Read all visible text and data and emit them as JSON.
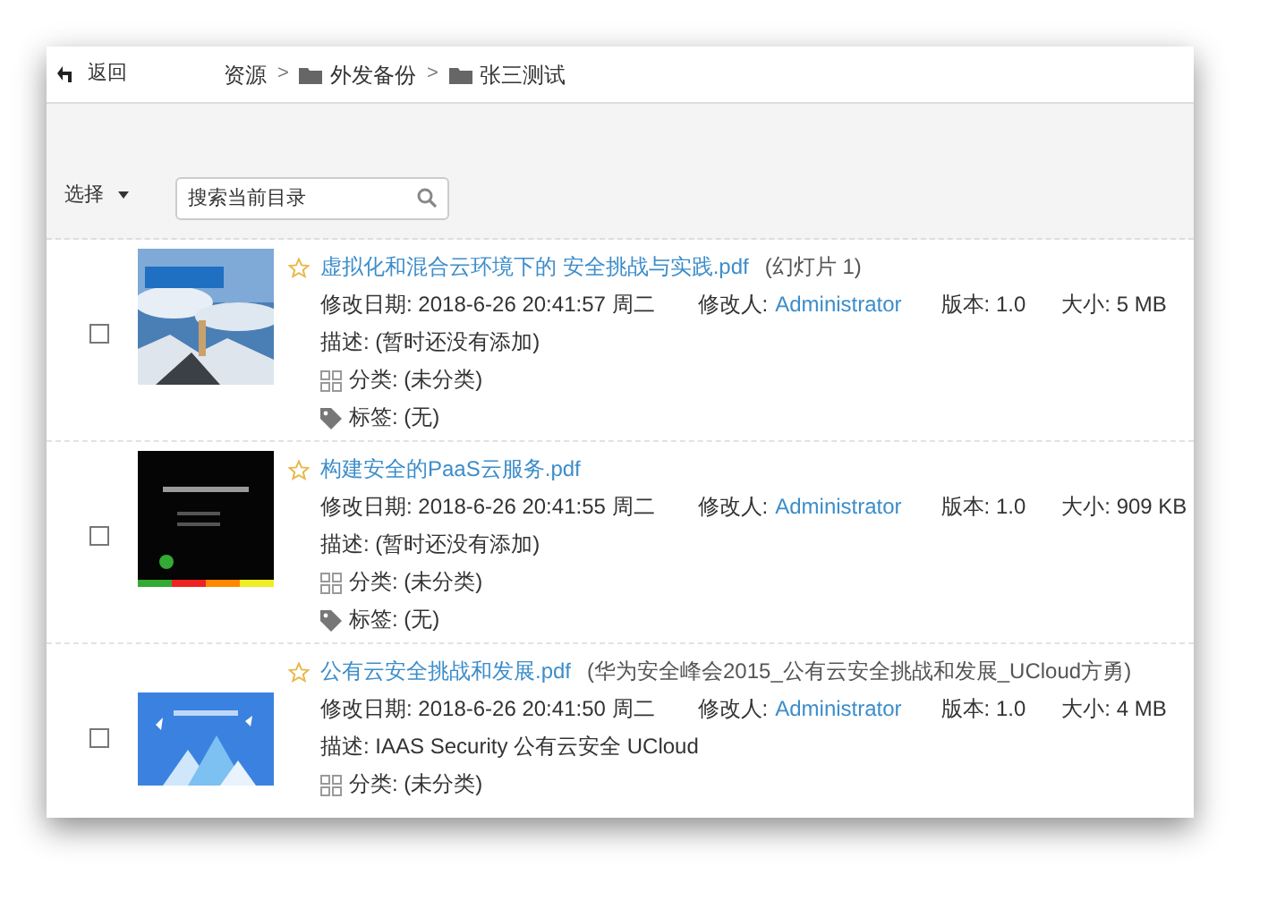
{
  "toolbar": {
    "back": "返回",
    "breadcrumb": [
      {
        "label": "资源",
        "folder": false
      },
      {
        "sep": ">",
        "label": "外发备份",
        "folder": true
      },
      {
        "sep": ">",
        "label": "张三测试",
        "folder": true
      }
    ]
  },
  "filter": {
    "select": "选择",
    "search": {
      "placeholder": "搜索当前目录"
    }
  },
  "files": [
    {
      "checked": false,
      "starred": false,
      "title": "虚拟化和混合云环境下的 安全挑战与实践.pdf",
      "note": "(幻灯片 1)",
      "date": "修改日期: 2018-6-26 20:41:57 周二",
      "modifier_label": "修改人:",
      "modifier": "Administrator",
      "version": "版本: 1.0",
      "size": "大小: 5 MB",
      "description": "描述: (暂时还没有添加)",
      "category": "分类: (未分类)",
      "tags": "标签: (无)"
    },
    {
      "checked": false,
      "starred": false,
      "title": "构建安全的PaaS云服务.pdf",
      "date": "修改日期: 2018-6-26 20:41:55 周二",
      "modifier_label": "修改人:",
      "modifier": "Administrator",
      "version": "版本: 1.0",
      "size": "大小: 909 KB",
      "description": "描述: (暂时还没有添加)",
      "category": "分类: (未分类)",
      "tags": "标签: (无)"
    },
    {
      "checked": false,
      "starred": false,
      "title": "公有云安全挑战和发展.pdf",
      "note": "(华为安全峰会2015_公有云安全挑战和发展_UCloud方勇)",
      "date": "修改日期: 2018-6-26 20:41:50 周二",
      "modifier_label": "修改人:",
      "modifier": "Administrator",
      "version": "版本: 1.0",
      "size": "大小: 4 MB",
      "description": "描述: IAAS Security 公有云安全 UCloud",
      "category": "分类: (未分类)"
    }
  ]
}
